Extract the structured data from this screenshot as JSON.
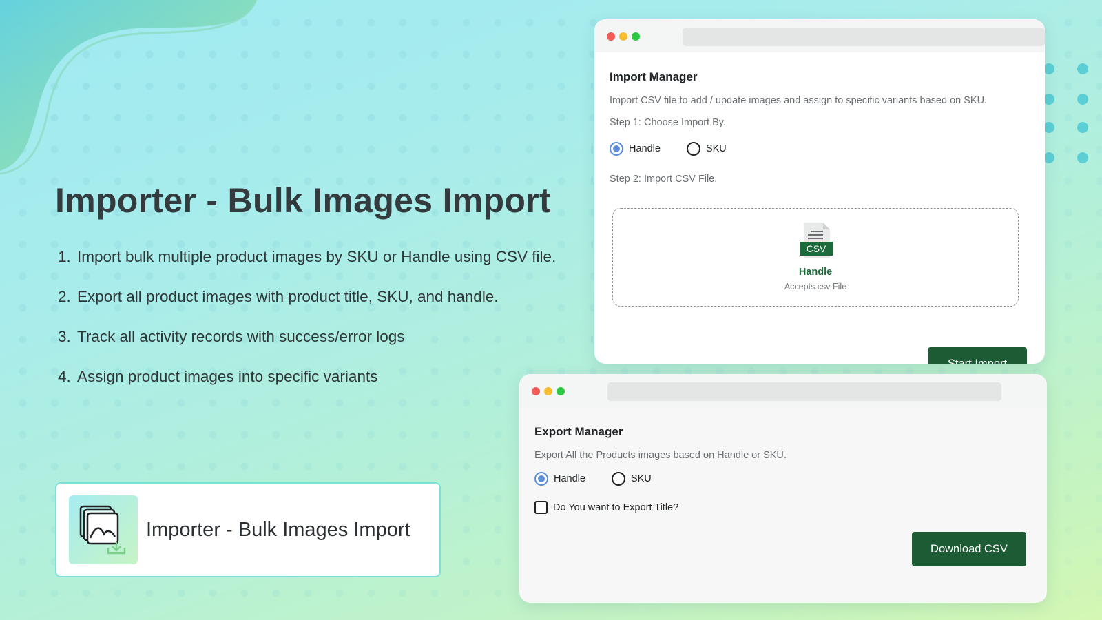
{
  "hero": {
    "title": "Importer - Bulk Images Import",
    "features": [
      {
        "num": "1.",
        "text": "Import bulk multiple product images by SKU or Handle using CSV file."
      },
      {
        "num": "2.",
        "text": "Export all product images with product title, SKU, and handle."
      },
      {
        "num": "3.",
        "text": "Track all activity records with success/error logs"
      },
      {
        "num": "4.",
        "text": "Assign product images into specific variants"
      }
    ]
  },
  "app_card": {
    "name": "Importer - Bulk Images Import",
    "icon": "images-download-icon"
  },
  "import_manager": {
    "title": "Import Manager",
    "description": "Import CSV file to add / update images and assign to specific  variants based on SKU.",
    "step1": "Step 1: Choose Import By.",
    "options": [
      {
        "label": "Handle",
        "selected": true
      },
      {
        "label": "SKU",
        "selected": false
      }
    ],
    "step2": "Step 2: Import CSV File.",
    "dropzone": {
      "file_badge": "CSV",
      "label": "Handle",
      "hint": "Accepts.csv File"
    },
    "button": "Start Import"
  },
  "export_manager": {
    "title": "Export Manager",
    "description": "Export All the Products images based on  Handle or SKU.",
    "options": [
      {
        "label": "Handle",
        "selected": true
      },
      {
        "label": "SKU",
        "selected": false
      }
    ],
    "checkbox": {
      "label": "Do You want to Export Title?",
      "checked": false
    },
    "button": "Download CSV"
  },
  "colors": {
    "primary_button": "#1d5b35",
    "radio_selected": "#5b8fd9",
    "window_dot_red": "#f25c54",
    "window_dot_yellow": "#f6bd2e",
    "window_dot_green": "#2cc842"
  }
}
